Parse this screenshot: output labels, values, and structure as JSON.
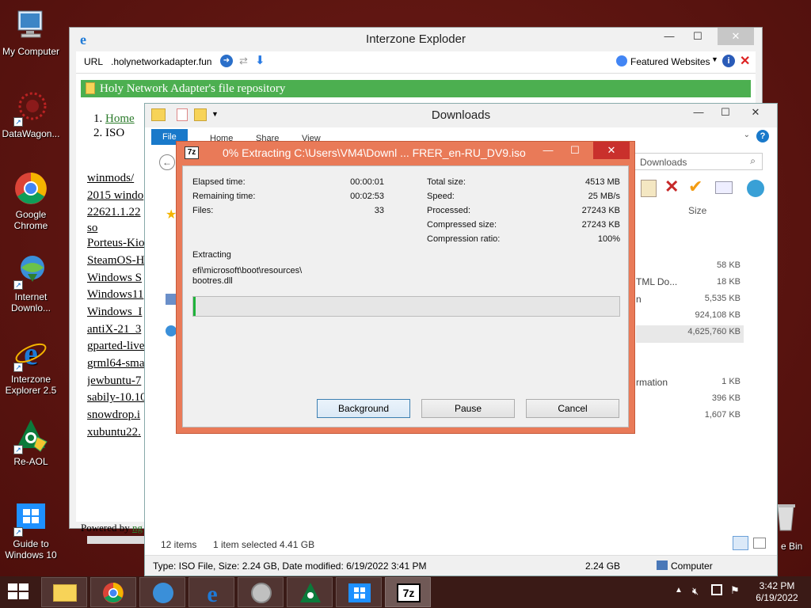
{
  "desktop": {
    "icons": [
      {
        "label": "My Computer"
      },
      {
        "label": "DataWagon..."
      },
      {
        "label": "Google Chrome"
      },
      {
        "label": "Internet Downlo..."
      },
      {
        "label": "Interzone Explorer 2.5"
      },
      {
        "label": "Re-AOL"
      },
      {
        "label": "Guide to Windows 10"
      }
    ],
    "recycle_label": "e Bin"
  },
  "browser": {
    "title": "Interzone Exploder",
    "url_label": "URL",
    "url_value": ".holynetworkadapter.fun",
    "featured": "Featured Websites",
    "banner": "Holy Network Adapter's file repository",
    "breadcrumb": [
      {
        "num": "1.",
        "text": "Home"
      },
      {
        "num": "2.",
        "text": "ISO"
      }
    ],
    "links": [
      "winmods/",
      "2015 windo",
      "22621.1.22",
      "so",
      "Porteus-Kio",
      "SteamOS-H",
      "Windows S",
      "Windows11",
      "Windows_I",
      "antiX-21_3",
      "gparted-live",
      "grml64-sma",
      "jewbuntu-7",
      "sabily-10.10",
      "snowdrop.i",
      "xubuntu22."
    ],
    "footer": "Powered by",
    "footer_link": "ng"
  },
  "explorer": {
    "title": "Downloads",
    "tabs": {
      "file": "File",
      "home": "Home",
      "share": "Share",
      "view": "View"
    },
    "search_placeholder": "Downloads",
    "col_size": "Size",
    "sizes": [
      "58 KB",
      "18 KB",
      "5,535 KB",
      "924,108 KB",
      "4,625,760 KB",
      "1 KB",
      "396 KB",
      "1,607 KB"
    ],
    "type_fragments": [
      "TML Do...",
      "n",
      "rmation"
    ],
    "status_items": "12 items",
    "status_selected": "1 item selected  4.41 GB",
    "details_bar": "Type: ISO File, Size: 2.24 GB, Date modified: 6/19/2022 3:41 PM",
    "details_size": "2.24 GB",
    "details_location": "Computer"
  },
  "dialog": {
    "app_badge": "7z",
    "title": "0% Extracting C:\\Users\\VM4\\Downl ... FRER_en-RU_DV9.iso",
    "left": [
      {
        "label": "Elapsed time:",
        "value": "00:00:01"
      },
      {
        "label": "Remaining time:",
        "value": "00:02:53"
      },
      {
        "label": "Files:",
        "value": "33"
      }
    ],
    "right": [
      {
        "label": "Total size:",
        "value": "4513 MB"
      },
      {
        "label": "Speed:",
        "value": "25 MB/s"
      },
      {
        "label": "Processed:",
        "value": "27243 KB"
      },
      {
        "label": "Compressed size:",
        "value": "27243 KB"
      },
      {
        "label": "Compression ratio:",
        "value": "100%"
      }
    ],
    "extracting_label": "Extracting",
    "path_line1": "efi\\microsoft\\boot\\resources\\",
    "path_line2": "bootres.dll",
    "progress_fraction": 0.006,
    "buttons": {
      "background": "Background",
      "pause": "Pause",
      "cancel": "Cancel"
    }
  },
  "taskbar": {
    "time": "3:42 PM",
    "date": "6/19/2022",
    "seven_zip_label": "7z"
  },
  "colors": {
    "dialog_frame": "#e97a58",
    "close_red": "#c9302c",
    "progress_green": "#1fb33a",
    "banner_green": "#4caf50",
    "file_tab_blue": "#1979ca"
  }
}
